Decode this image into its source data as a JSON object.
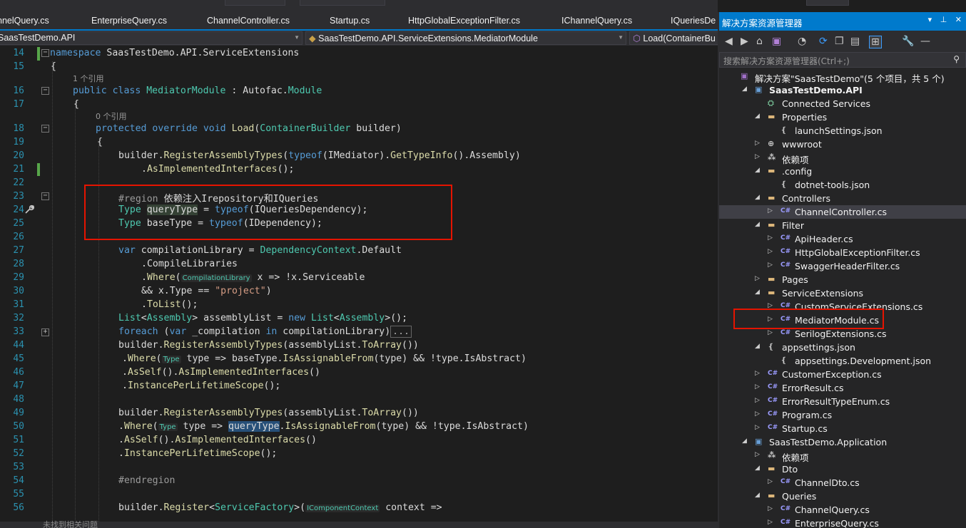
{
  "tabs": [
    "nnelQuery.cs",
    "EnterpriseQuery.cs",
    "ChannelController.cs",
    "Startup.cs",
    "HttpGlobalExceptionFilter.cs",
    "IChannelQuery.cs",
    "IQueriesDe"
  ],
  "nav": {
    "project": "SaasTestDemo.API",
    "class": "SaasTestDemo.API.ServiceExtensions.MediatorModule",
    "member": "Load(ContainerBu"
  },
  "editor": {
    "line_numbers": [
      "14",
      "15",
      "16",
      "17",
      "18",
      "19",
      "20",
      "21",
      "22",
      "23",
      "24",
      "25",
      "26",
      "27",
      "28",
      "29",
      "30",
      "31",
      "32",
      "33",
      "44",
      "45",
      "46",
      "47",
      "48",
      "49",
      "50",
      "51",
      "52",
      "53",
      "54",
      "55",
      "56"
    ],
    "codelens": [
      "1 个引用",
      "0 个引用"
    ],
    "lines": {
      "l14_kw": "namespace",
      "l14_rest": " SaasTestDemo.API.ServiceExtensions",
      "l15": "{",
      "l16_kw": "public class",
      "l16_cls": "MediatorModule",
      "l16_rest": " : Autofac.",
      "l16_mod": "Module",
      "l17": "{",
      "l18_kw": "protected override void",
      "l18_fn": "Load",
      "l18_open": "(",
      "l18_ty": "ContainerBuilder",
      "l18_rest": " builder)",
      "l19": "{",
      "l20_a": "builder.",
      "l20_fn": "RegisterAssemblyTypes",
      "l20_b": "(",
      "l20_kw": "typeof",
      "l20_c": "(IMediator).",
      "l20_fn2": "GetTypeInfo",
      "l20_d": "().Assembly)",
      "l21_a": ".",
      "l21_fn": "AsImplementedInterfaces",
      "l21_b": "();",
      "l23_pp": "#region",
      "l23_txt": " 依赖注入Irepository和IQueries",
      "l24_ty": "Type",
      "l24_var": "queryType",
      "l24_a": " = ",
      "l24_kw": "typeof",
      "l24_b": "(IQueriesDependency);",
      "l25_ty": "Type",
      "l25_a": " baseType = ",
      "l25_kw": "typeof",
      "l25_b": "(IDependency);",
      "l27_kw": "var",
      "l27_a": " compilationLibrary = ",
      "l27_ty": "DependencyContext",
      "l27_b": ".Default",
      "l28": ".CompileLibraries",
      "l29_a": ".",
      "l29_fn": "Where",
      "l29_b": "(",
      "l29_hint": "CompilationLibrary",
      "l29_c": " x => !x.Serviceable",
      "l30_a": "&& x.Type == ",
      "l30_st": "\"project\"",
      "l30_b": ")",
      "l31_a": ".",
      "l31_fn": "ToList",
      "l31_b": "();",
      "l32_ty": "List",
      "l32_a": "<",
      "l32_ty2": "Assembly",
      "l32_b": "> assemblyList = ",
      "l32_kw": "new",
      "l32_ty3": "List",
      "l32_c": "<",
      "l32_ty4": "Assembly",
      "l32_d": ">();",
      "l33_kw": "foreach",
      "l33_a": " (",
      "l33_kw2": "var",
      "l33_b": " _compilation ",
      "l33_kw3": "in",
      "l33_c": " compilationLibrary)",
      "l33_coll": "...",
      "l44_a": "builder.",
      "l44_fn": "RegisterAssemblyTypes",
      "l44_b": "(assemblyList.",
      "l44_fn2": "ToArray",
      "l44_c": "())",
      "l45_a": ".",
      "l45_fn": "Where",
      "l45_b": "(",
      "l45_hint": "Type",
      "l45_c": " type => baseType.",
      "l45_fn2": "IsAssignableFrom",
      "l45_d": "(type) && !type.IsAbstract)",
      "l46_a": ".",
      "l46_fn": "AsSelf",
      "l46_b": "().",
      "l46_fn2": "AsImplementedInterfaces",
      "l46_c": "()",
      "l47_a": ".",
      "l47_fn": "InstancePerLifetimeScope",
      "l47_b": "();",
      "l49_a": "builder.",
      "l49_fn": "RegisterAssemblyTypes",
      "l49_b": "(assemblyList.",
      "l49_fn2": "ToArray",
      "l49_c": "())",
      "l50_a": ".",
      "l50_fn": "Where",
      "l50_b": "(",
      "l50_hint": "Type",
      "l50_c": " type => ",
      "l50_var": "queryType",
      "l50_d": ".",
      "l50_fn2": "IsAssignableFrom",
      "l50_e": "(type) && !type.IsAbstract)",
      "l51_a": ".",
      "l51_fn": "AsSelf",
      "l51_b": "().",
      "l51_fn2": "AsImplementedInterfaces",
      "l51_c": "()",
      "l52_a": ".",
      "l52_fn": "InstancePerLifetimeScope",
      "l52_b": "();",
      "l54_pp": "#endregion",
      "l56_a": "builder.",
      "l56_fn": "Register",
      "l56_b": "<",
      "l56_ty": "ServiceFactory",
      "l56_c": ">(",
      "l56_hint": "IComponentContext",
      "l56_d": " context =>"
    }
  },
  "status": {
    "issues": "未找到相关问题"
  },
  "solution_explorer": {
    "title": "解决方案资源管理器",
    "search_placeholder": "搜索解决方案资源管理器(Ctrl+;)",
    "items": [
      {
        "label": "解决方案\"SaasTestDemo\"(5 个项目，共 5 个)",
        "icon": "solution-icon",
        "indent": 0
      },
      {
        "label": "SaasTestDemo.API",
        "icon": "project-icon",
        "indent": 1,
        "expanded": true,
        "bold": true
      },
      {
        "label": "Connected Services",
        "icon": "connected-services-icon",
        "indent": 2
      },
      {
        "label": "Properties",
        "icon": "folder-icon",
        "indent": 2,
        "expanded": true
      },
      {
        "label": "launchSettings.json",
        "icon": "json-file-icon",
        "indent": 3
      },
      {
        "label": "wwwroot",
        "icon": "globe-icon",
        "indent": 2,
        "expanded": false
      },
      {
        "label": "依赖项",
        "icon": "dependencies-icon",
        "indent": 2,
        "expanded": false
      },
      {
        "label": ".config",
        "icon": "folder-icon",
        "indent": 2,
        "expanded": true
      },
      {
        "label": "dotnet-tools.json",
        "icon": "json-file-icon",
        "indent": 3
      },
      {
        "label": "Controllers",
        "icon": "folder-icon",
        "indent": 2,
        "expanded": true
      },
      {
        "label": "ChannelController.cs",
        "icon": "csharp-file-icon",
        "indent": 3,
        "expanded": false,
        "selected": true
      },
      {
        "label": "Filter",
        "icon": "folder-icon",
        "indent": 2,
        "expanded": true
      },
      {
        "label": "ApiHeader.cs",
        "icon": "csharp-file-icon",
        "indent": 3,
        "expanded": false
      },
      {
        "label": "HttpGlobalExceptionFilter.cs",
        "icon": "csharp-file-icon",
        "indent": 3,
        "expanded": false
      },
      {
        "label": "SwaggerHeaderFilter.cs",
        "icon": "csharp-file-icon",
        "indent": 3,
        "expanded": false
      },
      {
        "label": "Pages",
        "icon": "folder-icon",
        "indent": 2,
        "expanded": false
      },
      {
        "label": "ServiceExtensions",
        "icon": "folder-icon",
        "indent": 2,
        "expanded": true
      },
      {
        "label": "CustomServiceExtensions.cs",
        "icon": "csharp-file-icon",
        "indent": 3,
        "expanded": false
      },
      {
        "label": "MediatorModule.cs",
        "icon": "csharp-file-icon",
        "indent": 3,
        "expanded": false
      },
      {
        "label": "SerilogExtensions.cs",
        "icon": "csharp-file-icon",
        "indent": 3,
        "expanded": false
      },
      {
        "label": "appsettings.json",
        "icon": "json-file-icon",
        "indent": 2,
        "expanded": true
      },
      {
        "label": "appsettings.Development.json",
        "icon": "json-file-icon",
        "indent": 3
      },
      {
        "label": "CustomerException.cs",
        "icon": "csharp-file-icon",
        "indent": 2,
        "expanded": false
      },
      {
        "label": "ErrorResult.cs",
        "icon": "csharp-file-icon",
        "indent": 2,
        "expanded": false
      },
      {
        "label": "ErrorResultTypeEnum.cs",
        "icon": "csharp-file-icon",
        "indent": 2,
        "expanded": false
      },
      {
        "label": "Program.cs",
        "icon": "csharp-file-icon",
        "indent": 2,
        "expanded": false
      },
      {
        "label": "Startup.cs",
        "icon": "csharp-file-icon",
        "indent": 2,
        "expanded": false
      },
      {
        "label": "SaasTestDemo.Application",
        "icon": "project-icon",
        "indent": 1,
        "expanded": true
      },
      {
        "label": "依赖项",
        "icon": "dependencies-icon",
        "indent": 2,
        "expanded": false
      },
      {
        "label": "Dto",
        "icon": "folder-icon",
        "indent": 2,
        "expanded": true
      },
      {
        "label": "ChannelDto.cs",
        "icon": "csharp-file-icon",
        "indent": 3,
        "expanded": false
      },
      {
        "label": "Queries",
        "icon": "folder-icon",
        "indent": 2,
        "expanded": true
      },
      {
        "label": "ChannelQuery.cs",
        "icon": "csharp-file-icon",
        "indent": 3,
        "expanded": false
      },
      {
        "label": "EnterpriseQuery.cs",
        "icon": "csharp-file-icon",
        "indent": 3,
        "expanded": false
      }
    ]
  },
  "colors": {
    "accent": "#007acc",
    "highlight_border": "#e51400",
    "editor_bg": "#1e1e1e"
  }
}
